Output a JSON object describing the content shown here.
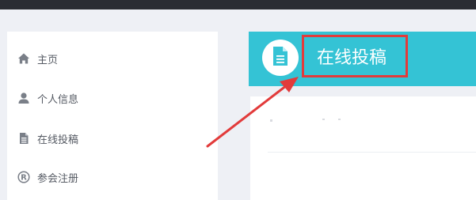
{
  "sidebar": {
    "items": [
      {
        "label": "主页",
        "icon": "home-icon"
      },
      {
        "label": "个人信息",
        "icon": "user-icon"
      },
      {
        "label": "在线投稿",
        "icon": "document-icon"
      },
      {
        "label": "参会注册",
        "icon": "registered-icon"
      }
    ]
  },
  "header": {
    "title": "在线投稿",
    "icon": "document-icon"
  },
  "colors": {
    "topbar": "#2a2d33",
    "background": "#eef0f5",
    "header": "#34c3d5",
    "highlight": "#e23b3b",
    "nav_text": "#555a63"
  }
}
